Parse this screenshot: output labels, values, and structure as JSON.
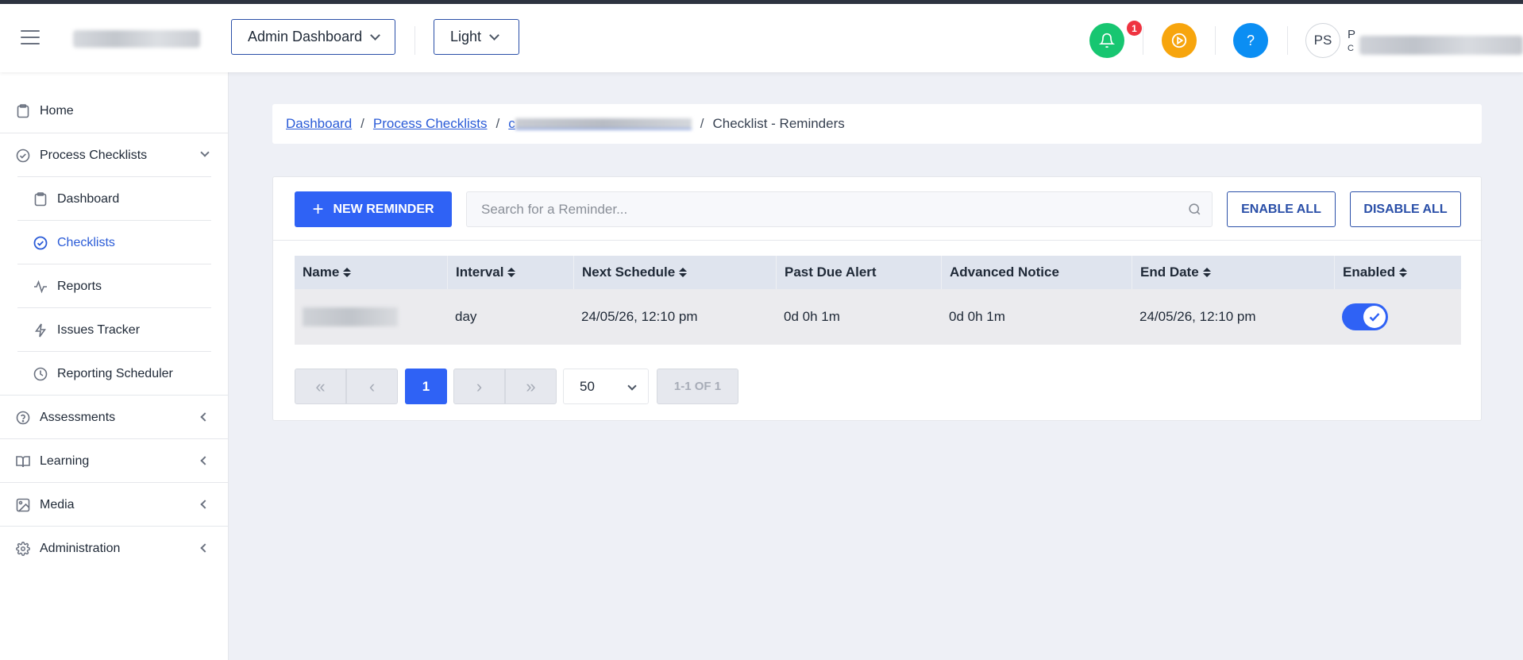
{
  "header": {
    "dashboard_select": "Admin Dashboard",
    "theme_select": "Light",
    "notification_count": "1",
    "avatar_initials": "PS",
    "user_initial_line1": "P",
    "user_initial_line2": "C",
    "notification_color": "#17c671",
    "play_color": "#f7a50d",
    "help_color": "#0b8ef3"
  },
  "sidebar": {
    "items": [
      {
        "label": "Home",
        "icon": "clipboard-icon"
      },
      {
        "label": "Process Checklists",
        "icon": "check-circle-icon"
      },
      {
        "label": "Dashboard",
        "icon": "clipboard-icon"
      },
      {
        "label": "Checklists",
        "icon": "check-circle-icon"
      },
      {
        "label": "Reports",
        "icon": "activity-icon"
      },
      {
        "label": "Issues Tracker",
        "icon": "lightning-icon"
      },
      {
        "label": "Reporting Scheduler",
        "icon": "clock-icon"
      },
      {
        "label": "Assessments",
        "icon": "help-circle-icon"
      },
      {
        "label": "Learning",
        "icon": "book-icon"
      },
      {
        "label": "Media",
        "icon": "image-icon"
      },
      {
        "label": "Administration",
        "icon": "gear-icon"
      }
    ]
  },
  "breadcrumb": {
    "dashboard": "Dashboard",
    "process_checklists": "Process Checklists",
    "checklist_initial": "c",
    "current": "Checklist - Reminders",
    "separator": "/"
  },
  "toolbar": {
    "new_reminder": "NEW REMINDER",
    "search_placeholder": "Search for a Reminder...",
    "enable_all": "ENABLE ALL",
    "disable_all": "DISABLE ALL"
  },
  "table": {
    "columns": [
      "Name",
      "Interval",
      "Next Schedule",
      "Past Due Alert",
      "Advanced Notice",
      "End Date",
      "Enabled"
    ],
    "rows": [
      {
        "interval": "day",
        "next_schedule": "24/05/26, 12:10 pm",
        "past_due_alert": "0d 0h 1m",
        "advanced_notice": "0d 0h 1m",
        "end_date": "24/05/26, 12:10 pm",
        "enabled": true
      }
    ]
  },
  "pagination": {
    "current_page": "1",
    "page_size": "50",
    "info": "1-1 OF 1",
    "first": "«",
    "prev": "‹",
    "next": "›",
    "last": "»"
  }
}
